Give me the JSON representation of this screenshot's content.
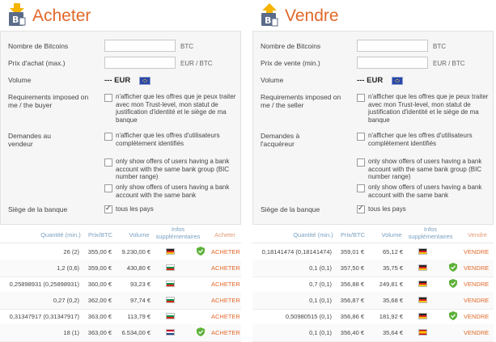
{
  "buy": {
    "title": "Acheter",
    "amount_label": "Nombre de Bitcoins",
    "amount_unit": "BTC",
    "price_label": "Prix d'achat (max.)",
    "price_unit": "EUR / BTC",
    "volume_label": "Volume",
    "volume_value": "--- EUR",
    "req_label": "Requirements imposed on me / the buyer",
    "req_option": "n'afficher que les offres que je peux traiter avec mon Trust-level, mon statut de justification d'identité et le siège de ma banque",
    "demands_label": "Demandes au vendeur",
    "demand_options": [
      "n'afficher que les offres d'utilisateurs complètement identifiés",
      "only show offers of users having a bank account with the same bank group (BIC number range)",
      "only show offers of users having a bank account with the same bank"
    ],
    "bank_label": "Siège de la banque",
    "bank_option": "tous les pays",
    "columns": [
      "Quantité (min.)",
      "Prix/BTC",
      "Volume",
      "Infos supplémentaires",
      "Acheter"
    ],
    "rows": [
      {
        "qty": "26 (2)",
        "price": "355,00 €",
        "volume": "9.230,00 €",
        "flag": "de",
        "verified": true,
        "action": "ACHETER"
      },
      {
        "qty": "1,2 (0,6)",
        "price": "359,00 €",
        "volume": "430,80 €",
        "flag": "bg",
        "verified": false,
        "action": "ACHETER"
      },
      {
        "qty": "0,25898931 (0,25898931)",
        "price": "360,00 €",
        "volume": "93,23 €",
        "flag": "bg",
        "verified": false,
        "action": "ACHETER"
      },
      {
        "qty": "0,27 (0,2)",
        "price": "362,00 €",
        "volume": "97,74 €",
        "flag": "bg",
        "verified": false,
        "action": "ACHETER"
      },
      {
        "qty": "0,31347917 (0,31347917)",
        "price": "363,00 €",
        "volume": "113,79 €",
        "flag": "bg",
        "verified": false,
        "action": "ACHETER"
      },
      {
        "qty": "18 (1)",
        "price": "363,00 €",
        "volume": "6.534,00 €",
        "flag": "nl",
        "verified": true,
        "action": "ACHETER"
      }
    ]
  },
  "sell": {
    "title": "Vendre",
    "amount_label": "Nombre de Bitcoins",
    "amount_unit": "BTC",
    "price_label": "Prix de vente (min.)",
    "price_unit": "EUR / BTC",
    "volume_label": "Volume",
    "volume_value": "--- EUR",
    "req_label": "Requirements imposed on me / the seller",
    "req_option": "n'afficher que les offres que je peux traiter avec mon Trust-level, mon statut de justification d'identité et le siège de ma banque",
    "demands_label": "Demandes à l'acquéreur",
    "demand_options": [
      "n'afficher que les offres d'utilisateurs complètement identifiés",
      "only show offers of users having a bank account with the same bank group (BIC number range)",
      "only show offers of users having a bank account with the same bank"
    ],
    "bank_label": "Siège de la banque",
    "bank_option": "tous les pays",
    "columns": [
      "Quantité (min.)",
      "Prix/BTC",
      "Volume",
      "Infos supplémentaires",
      "Vendre"
    ],
    "rows": [
      {
        "qty": "0,18141474 (0,18141474)",
        "price": "359,01 €",
        "volume": "65,12 €",
        "flag": "de",
        "verified": false,
        "action": "VENDRE"
      },
      {
        "qty": "0,1 (0,1)",
        "price": "357,50 €",
        "volume": "35,75 €",
        "flag": "de",
        "verified": true,
        "action": "VENDRE"
      },
      {
        "qty": "0,7 (0,1)",
        "price": "356,88 €",
        "volume": "249,81 €",
        "flag": "de",
        "verified": true,
        "action": "VENDRE"
      },
      {
        "qty": "0,1 (0,1)",
        "price": "356,87 €",
        "volume": "35,68 €",
        "flag": "de",
        "verified": false,
        "action": "VENDRE"
      },
      {
        "qty": "0,50980515 (0,1)",
        "price": "356,86 €",
        "volume": "181,92 €",
        "flag": "de",
        "verified": true,
        "action": "VENDRE"
      },
      {
        "qty": "0,1 (0,1)",
        "price": "356,40 €",
        "volume": "35,64 €",
        "flag": "es",
        "verified": false,
        "action": "VENDRE"
      }
    ]
  },
  "colors": {
    "accent": "#e2682a",
    "header_blue": "#7aa0c0",
    "verified_green": "#5cb13a"
  },
  "icons": {
    "logo": "bitcoin-document-icon",
    "verified": "shield-check-icon",
    "currency_flag": "eu-flag-icon"
  }
}
